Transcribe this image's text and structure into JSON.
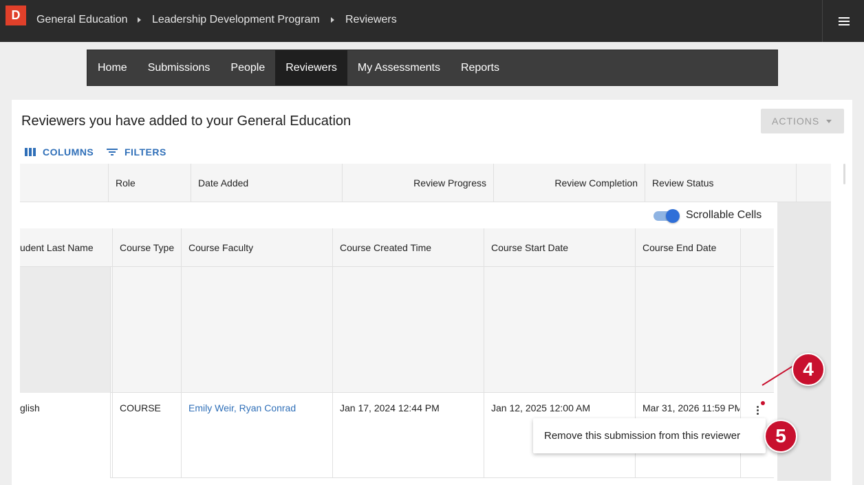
{
  "topbar": {
    "logo": "D",
    "breadcrumbs": [
      "General Education",
      "Leadership Development Program",
      "Reviewers"
    ]
  },
  "nav": {
    "items": [
      "Home",
      "Submissions",
      "People",
      "Reviewers",
      "My Assessments",
      "Reports"
    ],
    "active": "Reviewers"
  },
  "page": {
    "title": "Reviewers you have added to your General Education",
    "actions_label": "ACTIONS",
    "columns_label": "COLUMNS",
    "filters_label": "FILTERS"
  },
  "reviewer_table": {
    "headers": [
      "Role",
      "Date Added",
      "Review Progress",
      "Review Completion",
      "Review Status"
    ]
  },
  "submissions": {
    "scrollable_label": "Scrollable Cells",
    "headers": [
      "udent Last Name",
      "Course Type",
      "Course Faculty",
      "Course Created Time",
      "Course Start Date",
      "Course End Date"
    ],
    "row": {
      "student_last_name": "glish",
      "course_type": "COURSE",
      "course_faculty": "Emily Weir, Ryan Conrad",
      "course_created_time": "Jan 17, 2024 12:44 PM",
      "course_start_date": "Jan 12, 2025 12:00 AM",
      "course_end_date": "Mar 31, 2026 11:59 PM"
    }
  },
  "context_menu": {
    "remove_label": "Remove this submission from this reviewer"
  },
  "callouts": [
    "4",
    "5"
  ],
  "colors": {
    "topbar": "#2b2b2b",
    "accent": "#2f6fb8",
    "callout": "#c8102e",
    "logo": "#e0402a"
  }
}
